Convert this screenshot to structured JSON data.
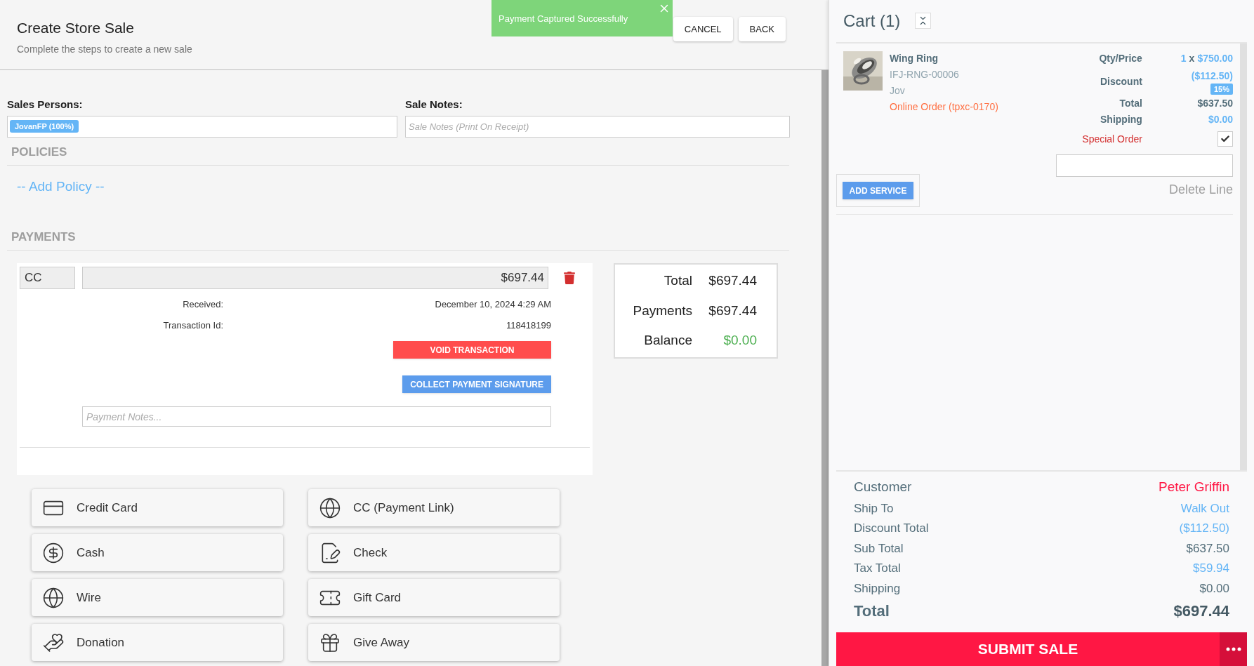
{
  "header": {
    "title": "Create Store Sale",
    "subtitle": "Complete the steps to create a new sale"
  },
  "toast": {
    "message": "Payment Captured Successfully"
  },
  "header_buttons": [
    "CANCEL",
    "BACK"
  ],
  "sales_persons": {
    "label": "Sales Persons:",
    "tags": [
      "JovanFP (100%)"
    ]
  },
  "sale_notes": {
    "label": "Sale Notes:",
    "placeholder": "Sale Notes (Print On Receipt)"
  },
  "policies": {
    "heading": "POLICIES",
    "add_link": "-- Add Policy --"
  },
  "payments": {
    "heading": "PAYMENTS",
    "entries": [
      {
        "method": "CC",
        "amount": "$697.44",
        "details": [
          {
            "label": "Received:",
            "value": "December 10, 2024 4:29 AM"
          },
          {
            "label": "Transaction Id:",
            "value": "118418199"
          }
        ],
        "void_button": "VOID TRANSACTION",
        "signature_button": "COLLECT PAYMENT SIGNATURE",
        "notes_placeholder": "Payment Notes..."
      }
    ]
  },
  "summary": [
    {
      "label": "Total",
      "value": "$697.44",
      "kind": "plain"
    },
    {
      "label": "Payments",
      "value": "$697.44",
      "kind": "plain"
    },
    {
      "label": "Balance",
      "value": "$0.00",
      "kind": "positive"
    }
  ],
  "payment_methods": [
    {
      "label": "Credit Card"
    },
    {
      "label": "CC (Payment Link)"
    },
    {
      "label": "Cash"
    },
    {
      "label": "Check"
    },
    {
      "label": "Wire"
    },
    {
      "label": "Gift Card"
    },
    {
      "label": "Donation"
    },
    {
      "label": "Give Away"
    }
  ],
  "cart": {
    "title": "Cart (1)",
    "items": [
      {
        "name": "Wing Ring",
        "sku": "IFJ-RNG-00006",
        "salesperson": "Jov",
        "order": "Online Order (tpxc-0170)",
        "qty_label": "Qty/Price",
        "qty": "1",
        "times": "x",
        "price": "$750.00",
        "discount_label": "Discount",
        "discount": "($112.50)",
        "discount_badge": "15%",
        "total_label": "Total",
        "total": "$637.50",
        "shipping_label": "Shipping",
        "shipping": "$0.00",
        "special_order": {
          "label": "Special Order",
          "checked": true
        },
        "delete_label": "Delete Line",
        "add_service": "ADD SERVICE"
      }
    ]
  },
  "totals": [
    {
      "label": "Customer",
      "value": "Peter Griffin",
      "kind": "name"
    },
    {
      "label": "Ship To",
      "value": "Walk Out",
      "kind": "link"
    },
    {
      "label": "Discount Total",
      "value": "($112.50)",
      "kind": "link"
    },
    {
      "label": "Sub Total",
      "value": "$637.50",
      "kind": "plain"
    },
    {
      "label": "Tax Total",
      "value": "$59.94",
      "kind": "link"
    },
    {
      "label": "Shipping",
      "value": "$0.00",
      "kind": "plain"
    },
    {
      "label": "Total",
      "value": "$697.44",
      "kind": "grand"
    }
  ],
  "submit_button": "SUBMIT SALE"
}
